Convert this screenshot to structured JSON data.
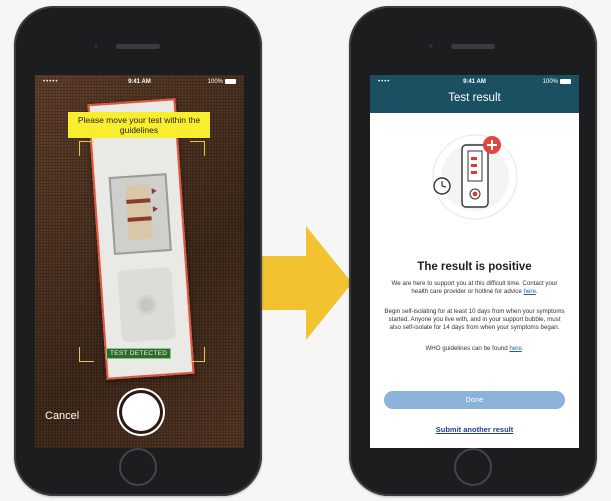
{
  "colors": {
    "arrow": "#f2c230",
    "header": "#1a5061",
    "banner": "#f8ee2e",
    "detected": "#2f6b2a",
    "done_button": "#8bb3d9",
    "link": "#1f5fa8"
  },
  "left_phone": {
    "status": {
      "signal": "•••••",
      "time": "9:41 AM",
      "battery": "100%"
    },
    "banner_text": "Please move your test within the guidelines",
    "detected_label": "TEST DETECTED",
    "cancel_label": "Cancel",
    "shutter_icon": "shutter-button-icon"
  },
  "right_phone": {
    "status": {
      "signal": "•••• ",
      "time": "9:41 AM",
      "battery": "100%"
    },
    "title": "Test result",
    "illustration_icon": "positive-test-device-icon",
    "heading": "The result is positive",
    "para1_text": "We are here to support you at this difficult time. Contact your health care provider or hotline for advice",
    "para1_link": "here",
    "para2_text": "Begin self-isolating for at least 10 days from when your symptoms started. Anyone you live with, and in your support bubble, must also self-isolate for 14 days from when your symptoms began.",
    "para3_text": "WHO guidelines can be found",
    "para3_link": "here",
    "done_label": "Done",
    "submit_label": "Submit another result"
  }
}
